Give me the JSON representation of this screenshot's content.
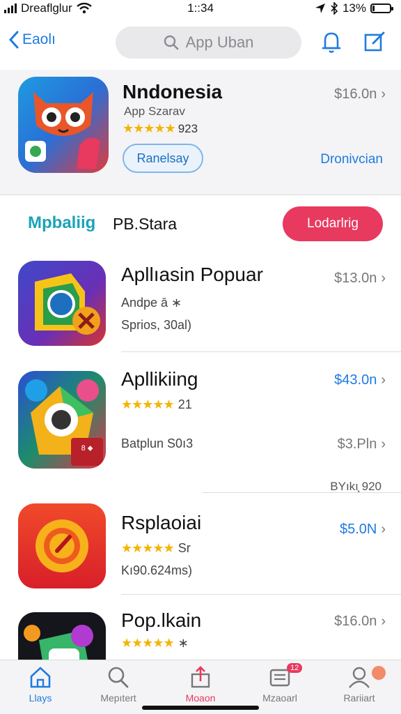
{
  "status": {
    "carrier": "Dreaflglur",
    "time": "1::34",
    "battery": "13%",
    "battery_level": 0.13
  },
  "header": {
    "back_label": "Eaolı",
    "search_placeholder": "App Uban",
    "icons": [
      "bell-icon",
      "compose-icon"
    ]
  },
  "featured": {
    "title": "Nndonesia",
    "subtitle": "App Szarav",
    "stars": "★★★★★",
    "rating": "923",
    "button": "Ranelsay",
    "price": "$16.0n",
    "link": "Dronivcian"
  },
  "section": {
    "title": "Mpbaliig",
    "subtitle": "PB.Stara",
    "button": "Lodarlrig"
  },
  "apps": [
    {
      "title": "Apllıasin Popuar",
      "line1": "Andpe ā ∗",
      "line2": "Sprios, 30al)",
      "price": "$13.0n",
      "price_color": "grey"
    },
    {
      "title": "Apllikiing",
      "stars": "★★★★★",
      "rating": "21",
      "line2": "Batplun S0ı3",
      "price": "$43.0n",
      "price_color": "blue",
      "price2": "$3.Pln",
      "extra": "BΥıkı̧ 920"
    },
    {
      "title": "Rsplaoiai",
      "stars": "★★★★★",
      "rating": "Sr",
      "line2": "Κı90.624ms)",
      "price": "$5.0N",
      "price_color": "blue"
    },
    {
      "title": "Pop.lkain",
      "stars": "★★★★★",
      "rating": "∗",
      "price": "$16.0n",
      "price_color": "grey"
    }
  ],
  "tabs": [
    {
      "label": "Llays",
      "icon": "home-icon"
    },
    {
      "label": "Mepıtert",
      "icon": "search-icon"
    },
    {
      "label": "Moaon",
      "icon": "share-icon"
    },
    {
      "label": "Mzaoarl",
      "icon": "updates-icon",
      "badge": "12"
    },
    {
      "label": "Rariiart",
      "icon": "profile-icon"
    }
  ]
}
